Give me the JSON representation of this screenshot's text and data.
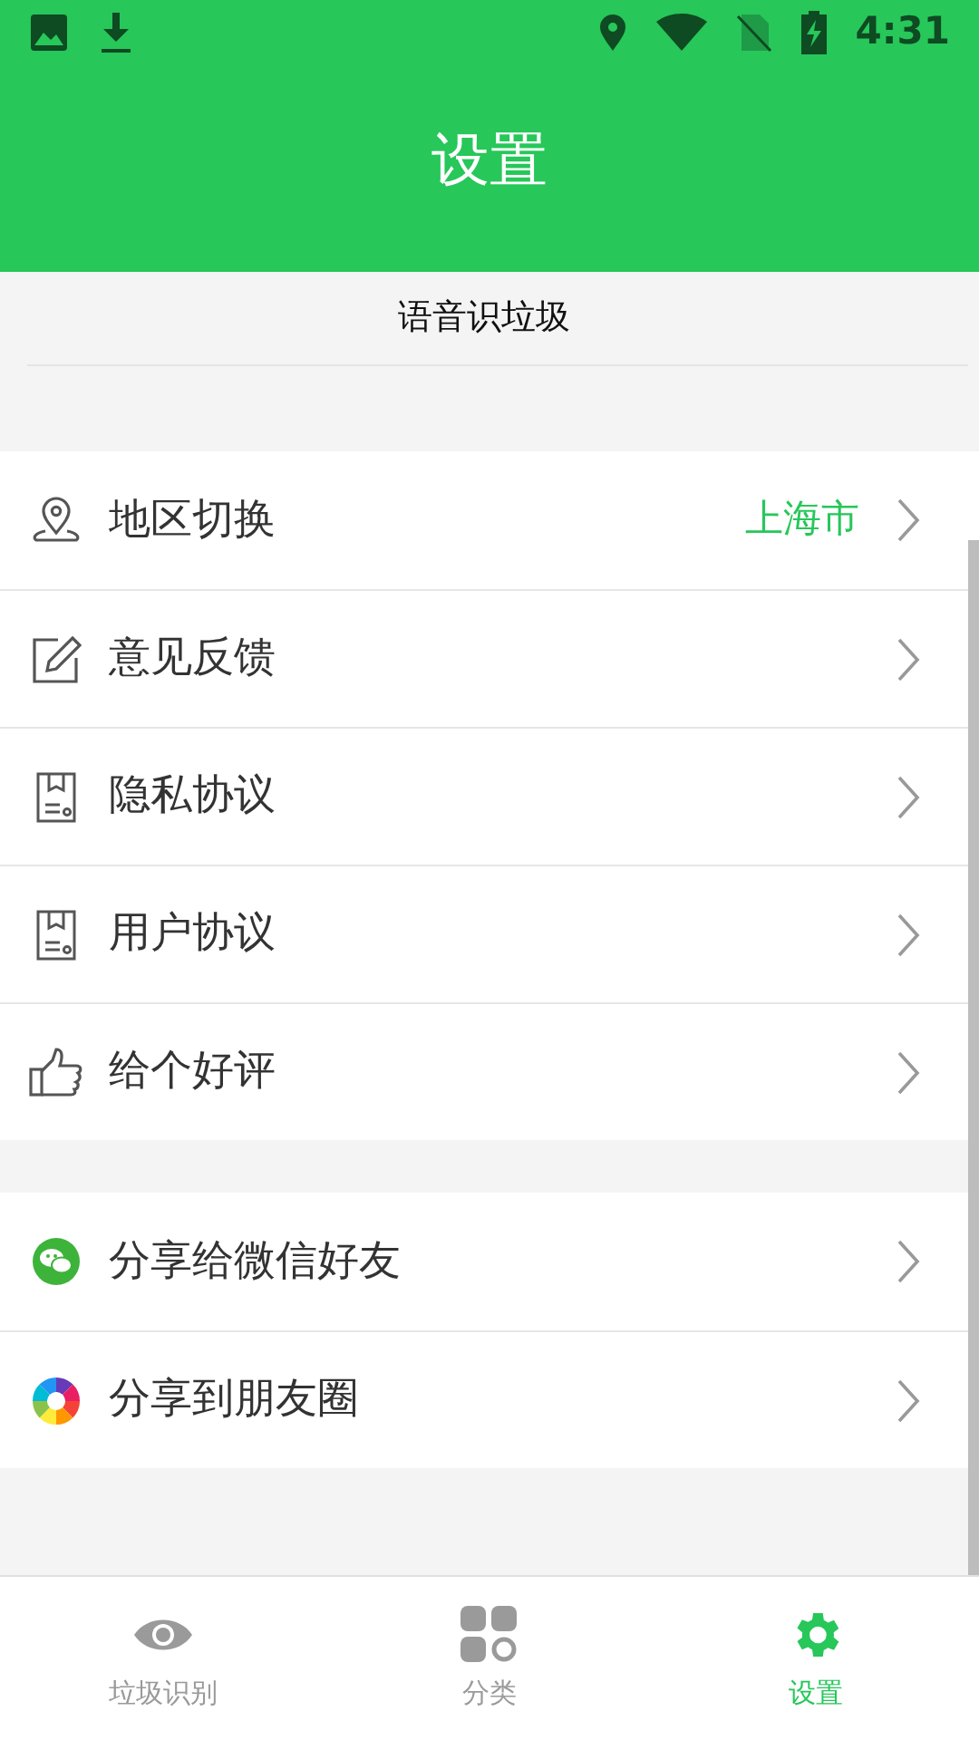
{
  "status_bar": {
    "time": "4:31"
  },
  "header": {
    "title": "设置"
  },
  "voice_label": "语音识垃圾",
  "sections": [
    {
      "items": [
        {
          "label": "地区切换",
          "value": "上海市"
        },
        {
          "label": "意见反馈"
        },
        {
          "label": "隐私协议"
        },
        {
          "label": "用户协议"
        },
        {
          "label": "给个好评"
        }
      ]
    },
    {
      "items": [
        {
          "label": "分享给微信好友"
        },
        {
          "label": "分享到朋友圈"
        }
      ]
    }
  ],
  "bottom_nav": [
    {
      "label": "垃圾识别",
      "selected": false
    },
    {
      "label": "分类",
      "selected": false
    },
    {
      "label": "设置",
      "selected": true
    }
  ]
}
